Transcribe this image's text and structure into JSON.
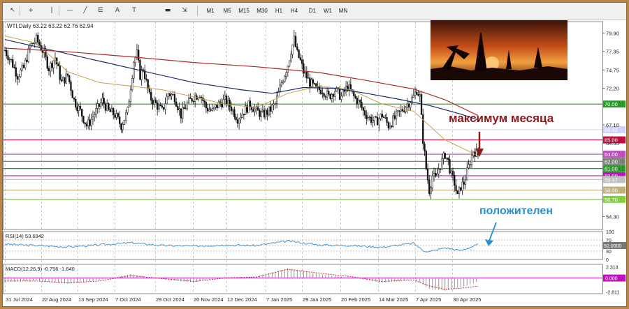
{
  "toolbar": {
    "tools": [
      {
        "name": "cursor-tool-icon",
        "glyph": "↖"
      },
      {
        "name": "crosshair-tool-icon",
        "glyph": "+"
      },
      {
        "name": "vertical-line-tool-icon",
        "glyph": "|"
      },
      {
        "name": "horizontal-line-tool-icon",
        "glyph": "—"
      },
      {
        "name": "trendline-tool-icon",
        "glyph": "╱"
      },
      {
        "name": "fibonacci-tool-icon",
        "glyph": "⋿"
      },
      {
        "name": "text-tool-icon",
        "glyph": "A"
      },
      {
        "name": "text-label-tool-icon",
        "glyph": "T"
      },
      {
        "name": "shape-tool-icon",
        "glyph": "▬"
      },
      {
        "name": "arrows-tool-icon",
        "glyph": "⇲"
      }
    ],
    "timeframes": [
      "M1",
      "M5",
      "M15",
      "M30",
      "H1",
      "H4",
      "D1",
      "W1",
      "MN"
    ]
  },
  "colors": {
    "candle": "#111111",
    "ma_fast": "#c9a04a",
    "ma_mid": "#1a2a6a",
    "ma_slow": "#b02a2a",
    "rsi_line": "#3a8ac8",
    "macd_hist": "#888888",
    "macd_signal": "#c02020",
    "annotation_red": "#8b1a1a",
    "annotation_blue": "#2a8fd0"
  },
  "chart_data": {
    "type": "candlestick",
    "title": "WTI,Daily  63.22 63.22 62.76 62.94",
    "ylim": [
      52.5,
      81.5
    ],
    "y_ticks": [
      "79.90",
      "77.35",
      "74.75",
      "72.20",
      "67.10",
      "64.55",
      "54.30"
    ],
    "x_labels": [
      "31 Jul 2024",
      "22 Aug 2024",
      "13 Sep 2024",
      "7 Oct 2024",
      "29 Oct 2024",
      "20 Nov 2024",
      "12 Dec 2024",
      "7 Jan 2025",
      "29 Jan 2025",
      "20 Feb 2025",
      "14 Mar 2025",
      "7 Apr 2025",
      "30 Apr 2025"
    ],
    "close_path": [
      [
        0,
        77.5
      ],
      [
        4,
        76
      ],
      [
        8,
        74
      ],
      [
        12,
        75
      ],
      [
        16,
        78
      ],
      [
        20,
        79
      ],
      [
        24,
        77.5
      ],
      [
        28,
        75
      ],
      [
        32,
        76.5
      ],
      [
        36,
        73
      ],
      [
        40,
        74
      ],
      [
        44,
        70.5
      ],
      [
        48,
        69
      ],
      [
        52,
        67
      ],
      [
        54,
        67.5
      ],
      [
        58,
        69
      ],
      [
        62,
        70.5
      ],
      [
        66,
        69
      ],
      [
        70,
        68.5
      ],
      [
        74,
        67
      ],
      [
        78,
        69
      ],
      [
        82,
        76
      ],
      [
        84,
        77
      ],
      [
        86,
        74
      ],
      [
        88,
        75
      ],
      [
        92,
        71
      ],
      [
        96,
        70
      ],
      [
        100,
        69
      ],
      [
        104,
        71.5
      ],
      [
        108,
        71
      ],
      [
        112,
        68.5
      ],
      [
        116,
        70
      ],
      [
        120,
        71
      ],
      [
        124,
        71.5
      ],
      [
        128,
        69.5
      ],
      [
        132,
        69
      ],
      [
        136,
        70
      ],
      [
        140,
        70.5
      ],
      [
        144,
        69.5
      ],
      [
        148,
        68
      ],
      [
        152,
        69
      ],
      [
        156,
        70
      ],
      [
        160,
        69
      ],
      [
        164,
        68.5
      ],
      [
        168,
        69
      ],
      [
        172,
        70
      ],
      [
        176,
        73
      ],
      [
        180,
        75.5
      ],
      [
        182,
        77.5
      ],
      [
        184,
        79
      ],
      [
        186,
        77
      ],
      [
        188,
        76
      ],
      [
        190,
        74.5
      ],
      [
        194,
        73
      ],
      [
        198,
        72
      ],
      [
        202,
        72
      ],
      [
        206,
        71
      ],
      [
        210,
        72
      ],
      [
        214,
        71
      ],
      [
        218,
        72.5
      ],
      [
        222,
        71
      ],
      [
        226,
        70
      ],
      [
        228,
        69
      ],
      [
        232,
        68
      ],
      [
        236,
        67.5
      ],
      [
        240,
        68.5
      ],
      [
        244,
        67
      ],
      [
        248,
        68
      ],
      [
        252,
        69
      ],
      [
        256,
        70
      ],
      [
        260,
        71
      ],
      [
        262,
        72
      ],
      [
        264,
        71
      ],
      [
        266,
        65
      ],
      [
        268,
        61
      ],
      [
        270,
        58
      ],
      [
        272,
        60
      ],
      [
        274,
        59.5
      ],
      [
        276,
        61
      ],
      [
        278,
        62
      ],
      [
        280,
        63
      ],
      [
        282,
        62
      ],
      [
        284,
        60
      ],
      [
        286,
        59
      ],
      [
        288,
        57
      ],
      [
        290,
        58.5
      ],
      [
        292,
        59
      ],
      [
        294,
        60.5
      ],
      [
        296,
        62
      ],
      [
        298,
        63.5
      ],
      [
        300,
        63.2
      ],
      [
        301,
        62.94
      ]
    ],
    "n_bars": 302,
    "moving_averages": [
      {
        "color": "#c9a04a",
        "points": [
          [
            0,
            79.5
          ],
          [
            20,
            78.5
          ],
          [
            40,
            74.5
          ],
          [
            60,
            73
          ],
          [
            80,
            72.5
          ],
          [
            100,
            72
          ],
          [
            120,
            71
          ],
          [
            140,
            70
          ],
          [
            160,
            69.5
          ],
          [
            180,
            71.5
          ],
          [
            200,
            72.5
          ],
          [
            220,
            72
          ],
          [
            240,
            70
          ],
          [
            260,
            69
          ],
          [
            280,
            65
          ],
          [
            301,
            62.8
          ]
        ]
      },
      {
        "color": "#1a2a6a",
        "points": [
          [
            0,
            79
          ],
          [
            30,
            77.5
          ],
          [
            60,
            76
          ],
          [
            90,
            74.5
          ],
          [
            120,
            73
          ],
          [
            150,
            72
          ],
          [
            170,
            71.5
          ],
          [
            190,
            72.3
          ],
          [
            210,
            72.2
          ],
          [
            230,
            71.5
          ],
          [
            250,
            70.7
          ],
          [
            270,
            69.8
          ],
          [
            290,
            68.6
          ],
          [
            301,
            67.8
          ]
        ]
      },
      {
        "color": "#b02a2a",
        "points": [
          [
            0,
            77.8
          ],
          [
            40,
            77.3
          ],
          [
            80,
            76.6
          ],
          [
            120,
            75.8
          ],
          [
            160,
            75.2
          ],
          [
            200,
            74.4
          ],
          [
            230,
            73.3
          ],
          [
            260,
            72.1
          ],
          [
            280,
            70.6
          ],
          [
            301,
            68.4
          ]
        ]
      }
    ],
    "levels": [
      {
        "value": 70.0,
        "label": "70.00",
        "color": "#2a9a2a"
      },
      {
        "value": 66.42,
        "label": "66.42",
        "color": "#d0d0ff"
      },
      {
        "value": 65.0,
        "label": "65.00",
        "color": "#c01040"
      },
      {
        "value": 63.0,
        "label": "63.00",
        "color": "#c050c0"
      },
      {
        "value": 62.0,
        "label": "62.00",
        "color": "#808080"
      },
      {
        "value": 61.0,
        "label": "61.00",
        "color": "#2a9a2a"
      },
      {
        "value": 60.0,
        "label": "60.00",
        "color": "#c010c0"
      },
      {
        "value": 59.47,
        "label": "59.47",
        "color": "#c0c0c0"
      },
      {
        "value": 58.0,
        "label": "58.00",
        "color": "#c0b080"
      },
      {
        "value": 56.7,
        "label": "56.70",
        "color": "#80d040"
      }
    ],
    "rsi": {
      "label": "RSI(14) 53.6942",
      "ylim": [
        0,
        100
      ],
      "ticks": [
        "100",
        "70",
        "30",
        "0"
      ],
      "level_label": "50.0000",
      "points": [
        [
          0,
          55
        ],
        [
          20,
          50
        ],
        [
          40,
          45
        ],
        [
          60,
          52
        ],
        [
          80,
          60
        ],
        [
          100,
          50
        ],
        [
          120,
          48
        ],
        [
          140,
          52
        ],
        [
          160,
          50
        ],
        [
          180,
          66
        ],
        [
          200,
          52
        ],
        [
          220,
          50
        ],
        [
          240,
          44
        ],
        [
          260,
          58
        ],
        [
          266,
          32
        ],
        [
          270,
          28
        ],
        [
          280,
          42
        ],
        [
          290,
          32
        ],
        [
          301,
          53.69
        ]
      ]
    },
    "macd": {
      "label": "MACD(12,26,9) -0.756 -1.640",
      "ticks": [
        "2.314",
        "0.000",
        "-2.811"
      ],
      "ylim": [
        -3.2,
        2.8
      ],
      "hist": [
        [
          0,
          -0.8
        ],
        [
          20,
          -0.5
        ],
        [
          40,
          -1.2
        ],
        [
          60,
          -0.4
        ],
        [
          80,
          0.8
        ],
        [
          100,
          -0.3
        ],
        [
          120,
          -0.9
        ],
        [
          140,
          0.2
        ],
        [
          160,
          0.3
        ],
        [
          180,
          2.0
        ],
        [
          200,
          0.8
        ],
        [
          220,
          0.1
        ],
        [
          240,
          -1.0
        ],
        [
          260,
          -0.2
        ],
        [
          270,
          -2.2
        ],
        [
          280,
          -2.6
        ],
        [
          290,
          -1.9
        ],
        [
          301,
          -0.76
        ]
      ],
      "signal": [
        [
          0,
          -0.6
        ],
        [
          20,
          -0.6
        ],
        [
          40,
          -1.0
        ],
        [
          60,
          -0.6
        ],
        [
          80,
          0.5
        ],
        [
          100,
          -0.1
        ],
        [
          120,
          -0.7
        ],
        [
          140,
          0.0
        ],
        [
          160,
          0.2
        ],
        [
          180,
          1.8
        ],
        [
          200,
          1.0
        ],
        [
          220,
          0.3
        ],
        [
          240,
          -0.7
        ],
        [
          260,
          -0.4
        ],
        [
          270,
          -1.6
        ],
        [
          280,
          -2.3
        ],
        [
          290,
          -2.1
        ],
        [
          301,
          -1.64
        ]
      ]
    },
    "annotations": [
      {
        "text": "максимум месяца",
        "color": "#8b1a1a"
      },
      {
        "text": "положителен",
        "color": "#2a8fd0"
      }
    ]
  }
}
